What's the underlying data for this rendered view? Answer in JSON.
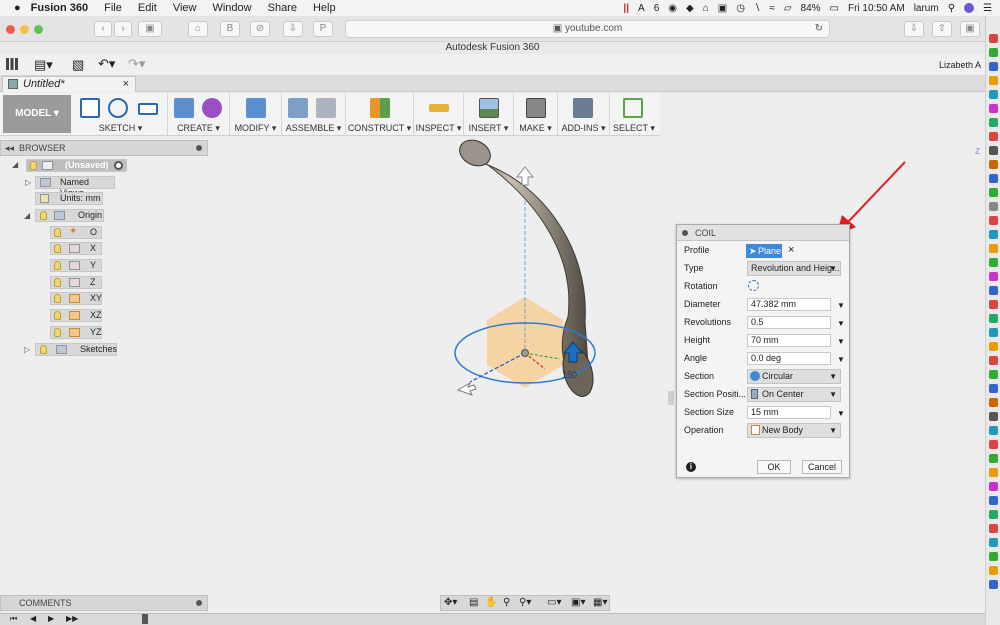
{
  "menubar": {
    "app_name": "Fusion 360",
    "items": [
      "File",
      "Edit",
      "View",
      "Window",
      "Share",
      "Help"
    ],
    "status_right": {
      "sixes": "6",
      "battery": "84%",
      "clock": "Fri 10:50 AM",
      "user": "larum"
    }
  },
  "browser": {
    "url": "youtube.com"
  },
  "fusion": {
    "window_title": "Autodesk Fusion 360",
    "user_label": "Lizabeth A",
    "doc_tab": "Untitled*",
    "workspace": "MODEL",
    "ribbon_groups": [
      "SKETCH",
      "CREATE",
      "MODIFY",
      "ASSEMBLE",
      "CONSTRUCT",
      "INSPECT",
      "INSERT",
      "MAKE",
      "ADD-INS",
      "SELECT"
    ]
  },
  "browser_panel": {
    "title": "BROWSER",
    "root": "(Unsaved)",
    "items": {
      "named_views": "Named Views",
      "units": "Units: mm",
      "origin": "Origin",
      "o": "O",
      "x": "X",
      "y": "Y",
      "z": "Z",
      "xy": "XY",
      "xz": "XZ",
      "yz": "YZ",
      "sketches": "Sketches"
    }
  },
  "coil_dialog": {
    "title": "COIL",
    "rows": {
      "profile": {
        "label": "Profile",
        "value": "Plane"
      },
      "type": {
        "label": "Type",
        "value": "Revolution and Heig..."
      },
      "rotation": {
        "label": "Rotation"
      },
      "diameter": {
        "label": "Diameter",
        "value": "47.382 mm"
      },
      "revolutions": {
        "label": "Revolutions",
        "value": "0.5"
      },
      "height": {
        "label": "Height",
        "value": "70 mm"
      },
      "angle": {
        "label": "Angle",
        "value": "0.0 deg"
      },
      "section": {
        "label": "Section",
        "value": "Circular"
      },
      "section_position": {
        "label": "Section Positi...",
        "value": "On Center"
      },
      "section_size": {
        "label": "Section Size",
        "value": "15 mm"
      },
      "operation": {
        "label": "Operation",
        "value": "New Body"
      }
    },
    "ok": "OK",
    "cancel": "Cancel"
  },
  "bottom": {
    "comments": "COMMENTS"
  },
  "viewport": {
    "dimension_label": "150"
  },
  "colors": {
    "model_button": "#9b9b9b",
    "coil_body": "#8a8375",
    "selection_blue": "#2b7bd3",
    "annotation_arrow": "#e02020",
    "plane_highlight": "#f7c98a"
  }
}
